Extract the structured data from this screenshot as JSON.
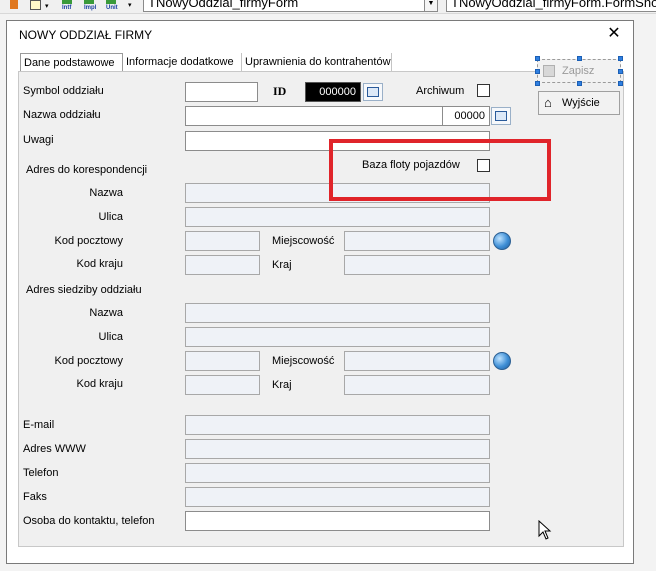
{
  "toolbar": {
    "intf_label": "Intf",
    "impl_label": "Impl",
    "unit_label": "Unit",
    "form_combo": "TNowyOddzial_firmyForm",
    "method_combo": "TNowyOddzial_firmyForm.FormShow"
  },
  "dialog": {
    "title": "NOWY ODDZIAŁ FIRMY",
    "close": "✕"
  },
  "tabs": [
    "Dane podstawowe",
    "Informacje dodatkowe",
    "Uprawnienia do kontrahentów"
  ],
  "buttons": {
    "save": "Zapisz",
    "exit": "Wyjście"
  },
  "form": {
    "symbol_label": "Symbol oddziału",
    "id_label": "ID",
    "id_value": "000000",
    "archive_label": "Archiwum",
    "name_label": "Nazwa oddziału",
    "name_code": "00000",
    "notes_label": "Uwagi",
    "fleet_label": "Baza floty pojazdów",
    "corr_section": "Adres do korespondencji",
    "hq_section": "Adres siedziby oddziału",
    "addr_name": "Nazwa",
    "addr_street": "Ulica",
    "addr_postal": "Kod pocztowy",
    "addr_city": "Miejscowość",
    "addr_country_code": "Kod kraju",
    "addr_country": "Kraj",
    "email_label": "E-mail",
    "www_label": "Adres WWW",
    "phone_label": "Telefon",
    "fax_label": "Faks",
    "contact_label": "Osoba do kontaktu, telefon"
  },
  "colors": {
    "highlight": "#e0242a",
    "id_field_bg": "#000000",
    "readonly_bg": "#eff2f7"
  }
}
